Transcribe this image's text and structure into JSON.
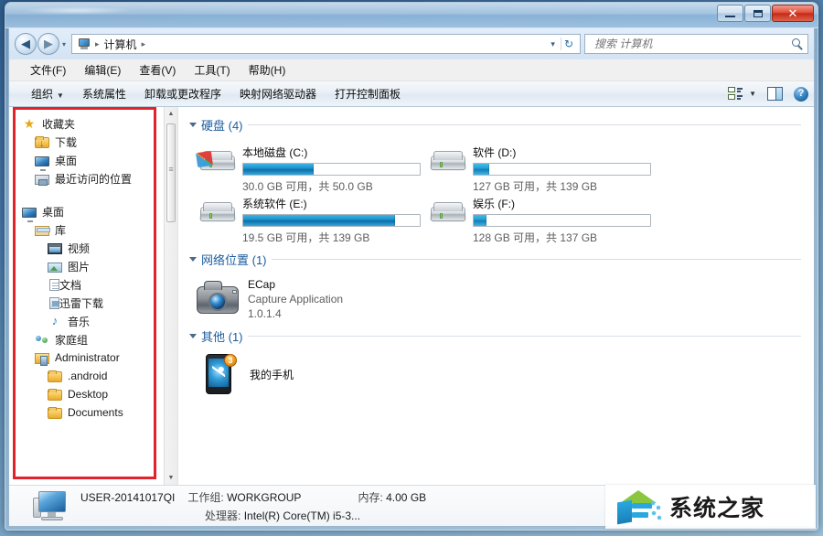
{
  "window": {
    "minimize_label": "最小化",
    "maximize_label": "最大化",
    "close_label": "✕"
  },
  "address": {
    "back_glyph": "◀",
    "forward_glyph": "▶",
    "history_glyph": "▾",
    "crumb_root": "计算机",
    "sep1": "▸",
    "sep2": "▸",
    "dropdown_glyph": "▾",
    "refresh_glyph": "↻"
  },
  "search": {
    "placeholder": "搜索 计算机",
    "value": ""
  },
  "menu": {
    "items": [
      {
        "label": "文件(F)"
      },
      {
        "label": "编辑(E)"
      },
      {
        "label": "查看(V)"
      },
      {
        "label": "工具(T)"
      },
      {
        "label": "帮助(H)"
      }
    ]
  },
  "commandbar": {
    "organize": "组织",
    "organize_caret": "▼",
    "items": [
      {
        "label": "系统属性"
      },
      {
        "label": "卸载或更改程序"
      },
      {
        "label": "映射网络驱动器"
      },
      {
        "label": "打开控制面板"
      }
    ],
    "views_caret": "▼",
    "help_glyph": "?"
  },
  "navpane": {
    "groups": [
      {
        "rows": [
          {
            "label": "收藏夹",
            "icon": "star-icon",
            "indent": 0
          },
          {
            "label": "下载",
            "icon": "download-folder-icon",
            "indent": 1
          },
          {
            "label": "桌面",
            "icon": "desktop-icon",
            "indent": 1
          },
          {
            "label": "最近访问的位置",
            "icon": "recent-places-icon",
            "indent": 1
          }
        ]
      },
      {
        "rows": [
          {
            "label": "桌面",
            "icon": "desktop-icon",
            "indent": 0
          },
          {
            "label": "库",
            "icon": "library-icon",
            "indent": 1
          },
          {
            "label": "视频",
            "icon": "video-icon",
            "indent": 2
          },
          {
            "label": "图片",
            "icon": "picture-icon",
            "indent": 2
          },
          {
            "label": "文档",
            "icon": "document-icon",
            "indent": 2
          },
          {
            "label": "迅雷下载",
            "icon": "thunder-download-icon",
            "indent": 2
          },
          {
            "label": "音乐",
            "icon": "music-icon",
            "indent": 2
          },
          {
            "label": "家庭组",
            "icon": "homegroup-icon",
            "indent": 1
          },
          {
            "label": "Administrator",
            "icon": "user-folder-icon",
            "indent": 1
          },
          {
            "label": ".android",
            "icon": "folder-icon",
            "indent": 2
          },
          {
            "label": "Desktop",
            "icon": "folder-icon",
            "indent": 2
          },
          {
            "label": "Documents",
            "icon": "folder-icon",
            "indent": 2
          }
        ]
      }
    ],
    "scroll_up_glyph": "▲",
    "scroll_down_glyph": "▼"
  },
  "content": {
    "sections": [
      {
        "title": "硬盘 (4)",
        "expanded": true
      },
      {
        "title": "网络位置 (1)",
        "expanded": true
      },
      {
        "title": "其他 (1)",
        "expanded": true
      }
    ],
    "drives": [
      {
        "name": "本地磁盘 (C:)",
        "capacity_text": "30.0 GB 可用，共 50.0 GB",
        "free_gb": 30.0,
        "total_gb": 50.0,
        "used_percent": 40,
        "system": true
      },
      {
        "name": "软件 (D:)",
        "capacity_text": "127 GB 可用，共 139 GB",
        "free_gb": 127,
        "total_gb": 139,
        "used_percent": 9,
        "system": false
      },
      {
        "name": "系统软件 (E:)",
        "capacity_text": "19.5 GB 可用，共 139 GB",
        "free_gb": 19.5,
        "total_gb": 139,
        "used_percent": 86,
        "system": false
      },
      {
        "name": "娱乐 (F:)",
        "capacity_text": "128 GB 可用，共 137 GB",
        "free_gb": 128,
        "total_gb": 137,
        "used_percent": 7,
        "system": false
      }
    ],
    "network_item": {
      "name": "ECap",
      "description": "Capture Application",
      "version": "1.0.1.4"
    },
    "other_item": {
      "name": "我的手机",
      "badge": "3"
    }
  },
  "details": {
    "computer_name": "USER-20141017QI",
    "workgroup_label": "工作组:",
    "workgroup_value": "WORKGROUP",
    "memory_label": "内存:",
    "memory_value": "4.00 GB",
    "processor_label": "处理器:",
    "processor_value": "Intel(R) Core(TM) i5-3..."
  },
  "watermark": {
    "text": "系统之家"
  },
  "colors": {
    "accent_blue": "#1b5c9e",
    "bar_fill": "#1f94cf",
    "annotation_red": "#e2232a",
    "close_red": "#c32b18"
  }
}
